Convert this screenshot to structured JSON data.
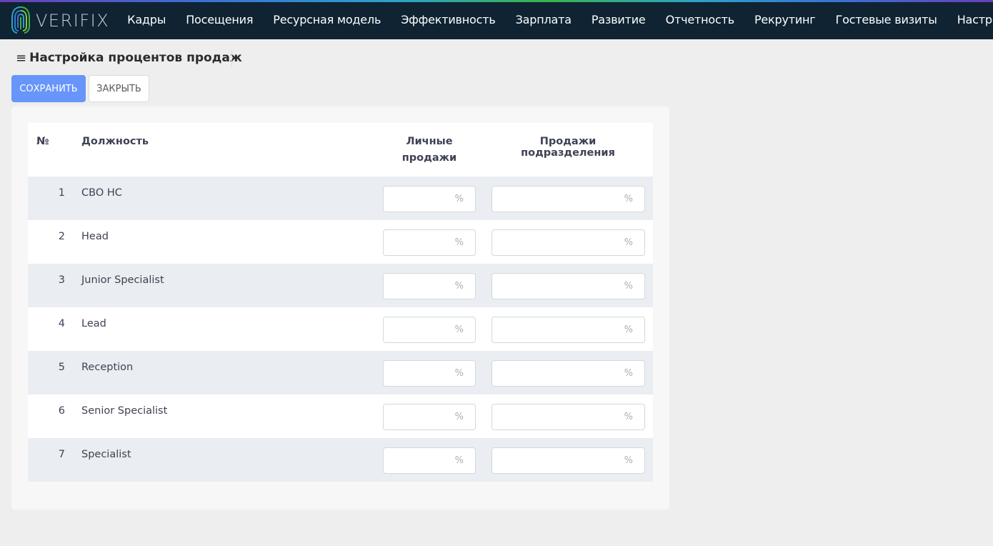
{
  "brand": {
    "name": "VERIFIX",
    "colors": {
      "nav_bg": "#0f2332",
      "accent": "#6795fa",
      "row_alt": "#eaedf1"
    }
  },
  "nav": {
    "items": [
      "Кадры",
      "Посещения",
      "Ресурсная модель",
      "Эффективность",
      "Зарплата",
      "Развитие",
      "Отчетность",
      "Рекрутинг",
      "Гостевые визиты",
      "Настройки"
    ]
  },
  "page": {
    "title": "Настройка процентов продаж",
    "menu_icon": "≡"
  },
  "toolbar": {
    "save_label": "СОХРАНИТЬ",
    "close_label": "ЗАКРЫТЬ"
  },
  "table": {
    "headers": {
      "num": "№",
      "position": "Должность",
      "personal": "Личные продажи",
      "department": "Продажи подразделения"
    },
    "unit": "%",
    "rows": [
      {
        "num": "1",
        "position": "CBO HC",
        "personal": "",
        "department": ""
      },
      {
        "num": "2",
        "position": "Head",
        "personal": "",
        "department": ""
      },
      {
        "num": "3",
        "position": "Junior Specialist",
        "personal": "",
        "department": ""
      },
      {
        "num": "4",
        "position": "Lead",
        "personal": "",
        "department": ""
      },
      {
        "num": "5",
        "position": "Reception",
        "personal": "",
        "department": ""
      },
      {
        "num": "6",
        "position": "Senior Specialist",
        "personal": "",
        "department": ""
      },
      {
        "num": "7",
        "position": "Specialist",
        "personal": "",
        "department": ""
      }
    ]
  }
}
